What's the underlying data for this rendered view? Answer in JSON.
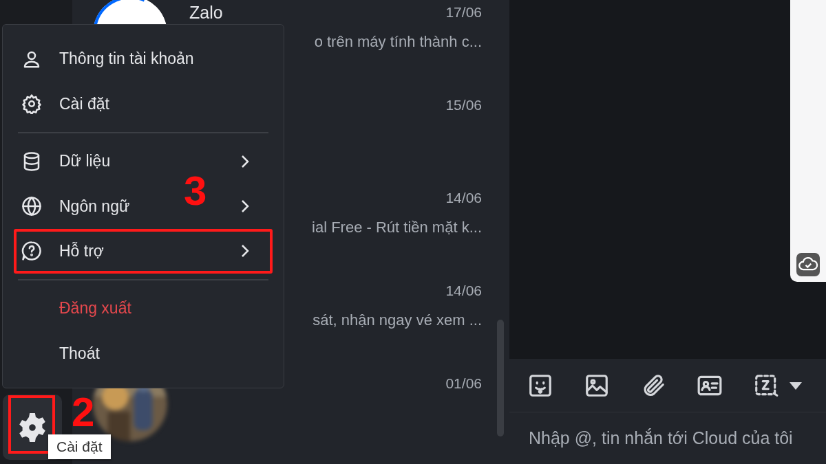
{
  "conversations": [
    {
      "name": "Zalo",
      "date": "17/06",
      "preview": "o trên máy tính thành c..."
    },
    {
      "date": "15/06"
    },
    {
      "date": "14/06",
      "preview": "ial Free - Rút tiền mặt k..."
    },
    {
      "date": "14/06",
      "preview": "sát, nhận ngay vé xem ..."
    },
    {
      "date": "01/06"
    }
  ],
  "menu": {
    "items": [
      {
        "label": "Thông tin tài khoản",
        "submenu": false,
        "kind": "normal",
        "annotated": false
      },
      {
        "label": "Cài đặt",
        "submenu": false,
        "kind": "normal",
        "annotated": false
      },
      {
        "kind": "divider"
      },
      {
        "label": "Dữ liệu",
        "submenu": true,
        "kind": "normal",
        "annotated": false
      },
      {
        "label": "Ngôn ngữ",
        "submenu": true,
        "kind": "normal",
        "annotated": false
      },
      {
        "label": "Hỗ trợ",
        "submenu": true,
        "kind": "normal",
        "annotated": true
      },
      {
        "kind": "divider"
      },
      {
        "label": "Đăng xuất",
        "submenu": false,
        "kind": "danger",
        "annotated": false
      },
      {
        "label": "Thoát",
        "submenu": false,
        "kind": "normal",
        "annotated": false
      }
    ]
  },
  "settings_button": {
    "annotated": true,
    "tooltip": "Cài đặt"
  },
  "annotations": [
    {
      "label": "3"
    },
    {
      "label": "2"
    }
  ],
  "composer": {
    "placeholder": "Nhập @, tin nhắn tới Cloud của tôi"
  }
}
